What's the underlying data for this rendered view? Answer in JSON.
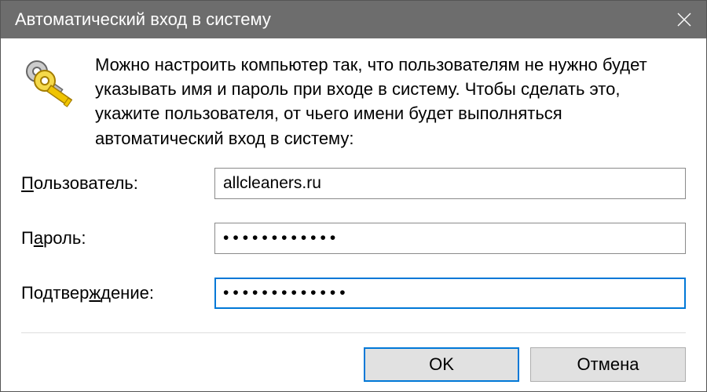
{
  "window": {
    "title": "Автоматический вход в систему"
  },
  "description": "Можно настроить компьютер так, что пользователям не нужно будет указывать имя и пароль при входе в систему. Чтобы сделать это, укажите пользователя, от чьего имени будет выполняться автоматический вход в систему:",
  "form": {
    "user_label_pre": "",
    "user_mnemonic": "П",
    "user_label_post": "ользователь:",
    "user_value": "allcleaners.ru",
    "password_label_pre": "П",
    "password_mnemonic": "а",
    "password_label_post": "роль:",
    "password_value": "••••••••••••",
    "confirm_label_pre": "Подтвер",
    "confirm_mnemonic": "ж",
    "confirm_label_post": "дение:",
    "confirm_value": "•••••••••••••"
  },
  "buttons": {
    "ok": "OK",
    "cancel": "Отмена"
  }
}
